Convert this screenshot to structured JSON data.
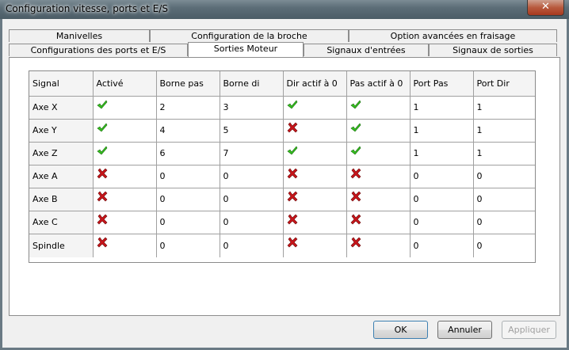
{
  "window": {
    "title": "Configuration vitesse, ports et E/S",
    "close_glyph": "✕"
  },
  "tabs": {
    "row1": [
      "Manivelles",
      "Configuration de la broche",
      "Option avancées en fraisage"
    ],
    "row2": [
      "Configurations des ports et E/S",
      "Sorties Moteur",
      "Signaux d'entrées",
      "Signaux de sorties"
    ],
    "active": "Sorties Moteur"
  },
  "table": {
    "columns": [
      "Signal",
      "Activé",
      "Borne pas",
      "Borne di",
      "Dir actif à 0",
      "Pas actif à 0",
      "Port Pas",
      "Port Dir"
    ],
    "rows": [
      {
        "signal": "Axe X",
        "active": true,
        "borne_pas": "2",
        "borne_dir": "3",
        "dir_low": true,
        "step_low": true,
        "port_pas": "1",
        "port_dir": "1"
      },
      {
        "signal": "Axe Y",
        "active": true,
        "borne_pas": "4",
        "borne_dir": "5",
        "dir_low": false,
        "step_low": true,
        "port_pas": "1",
        "port_dir": "1"
      },
      {
        "signal": "Axe Z",
        "active": true,
        "borne_pas": "6",
        "borne_dir": "7",
        "dir_low": true,
        "step_low": true,
        "port_pas": "1",
        "port_dir": "1"
      },
      {
        "signal": "Axe A",
        "active": false,
        "borne_pas": "0",
        "borne_dir": "0",
        "dir_low": false,
        "step_low": false,
        "port_pas": "0",
        "port_dir": "0"
      },
      {
        "signal": "Axe B",
        "active": false,
        "borne_pas": "0",
        "borne_dir": "0",
        "dir_low": false,
        "step_low": false,
        "port_pas": "0",
        "port_dir": "0"
      },
      {
        "signal": "Axe C",
        "active": false,
        "borne_pas": "0",
        "borne_dir": "0",
        "dir_low": false,
        "step_low": false,
        "port_pas": "0",
        "port_dir": "0"
      },
      {
        "signal": "Spindle",
        "active": false,
        "borne_pas": "0",
        "borne_dir": "0",
        "dir_low": false,
        "step_low": false,
        "port_pas": "0",
        "port_dir": "0"
      }
    ],
    "icons": {
      "true": "green-check-icon",
      "false": "red-x-icon"
    },
    "colors": {
      "check": "#36c21f",
      "cross": "#c8141a"
    }
  },
  "buttons": {
    "ok": "OK",
    "cancel": "Annuler",
    "apply": "Appliquer"
  }
}
